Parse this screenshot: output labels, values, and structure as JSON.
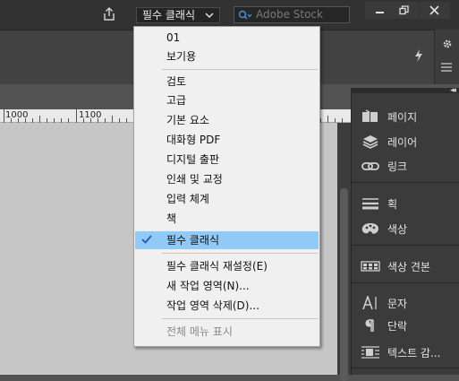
{
  "topbar": {
    "workspace_switcher": "필수 클래식",
    "stock_search_placeholder": "Adobe Stock"
  },
  "ruler": {
    "labels": [
      "1000",
      "1100"
    ]
  },
  "workspace_menu": {
    "items": [
      {
        "label": "01"
      },
      {
        "label": "보기용"
      },
      {
        "label": "검토"
      },
      {
        "label": "고급"
      },
      {
        "label": "기본 요소"
      },
      {
        "label": "대화형 PDF"
      },
      {
        "label": "디지털 출판"
      },
      {
        "label": "인쇄 및 교정"
      },
      {
        "label": "입력 체계"
      },
      {
        "label": "책"
      },
      {
        "label": "필수 클래식",
        "checked": true
      },
      {
        "label": "필수 클래식 재설정(E)"
      },
      {
        "label": "새 작업 영역(N)..."
      },
      {
        "label": "작업 영역 삭제(D)..."
      },
      {
        "label": "전체 메뉴 표시",
        "disabled": true
      }
    ]
  },
  "dock": {
    "items": [
      {
        "label": "페이지",
        "icon": "pages-icon"
      },
      {
        "label": "레이어",
        "icon": "layers-icon"
      },
      {
        "label": "링크",
        "icon": "links-icon"
      },
      {
        "label": "획",
        "icon": "stroke-icon"
      },
      {
        "label": "색상",
        "icon": "color-palette-icon"
      },
      {
        "label": "색상 견본",
        "icon": "swatches-icon"
      },
      {
        "label": "문자",
        "icon": "character-icon"
      },
      {
        "label": "단락",
        "icon": "paragraph-icon"
      },
      {
        "label": "텍스트 감...",
        "icon": "text-wrap-icon"
      }
    ]
  },
  "colors": {
    "menu_highlight": "#91c9f7",
    "check": "#1f5fae",
    "pasteboard": "#c6c6c6",
    "app_chrome": "#323232"
  }
}
